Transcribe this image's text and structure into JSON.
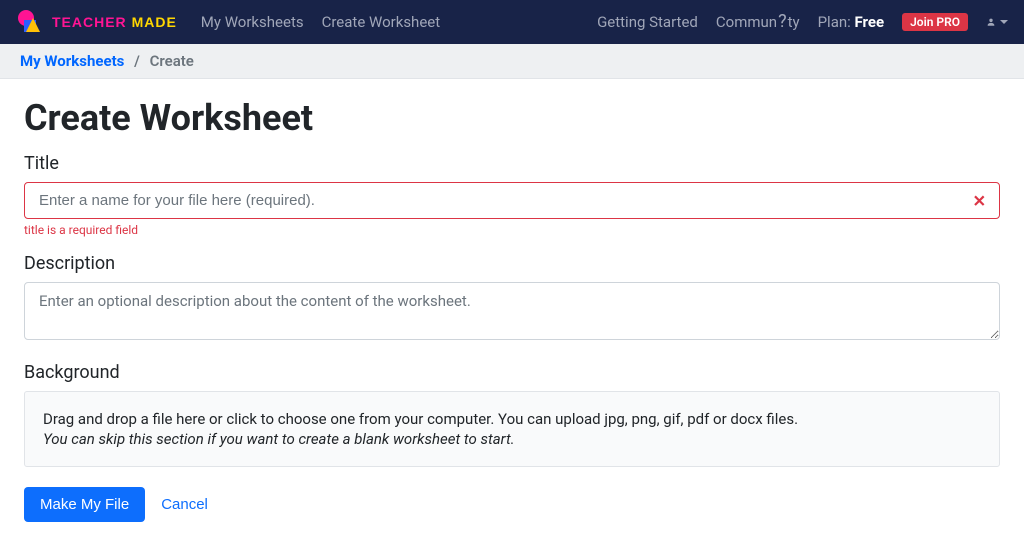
{
  "brand": {
    "teacher": "TEACHER",
    "made": "MADE"
  },
  "nav": {
    "my_worksheets": "My Worksheets",
    "create_worksheet": "Create Worksheet",
    "getting_started": "Getting Started",
    "community_prefix": "Commun",
    "community_suffix": "ty",
    "plan_label": "Plan: ",
    "plan_value": "Free",
    "join_pro": "Join PRO"
  },
  "breadcrumb": {
    "my_worksheets": "My Worksheets",
    "separator": "/",
    "current": "Create"
  },
  "page": {
    "title": "Create Worksheet"
  },
  "form": {
    "title_label": "Title",
    "title_placeholder": "Enter a name for your file here (required).",
    "title_error": "title is a required field",
    "description_label": "Description",
    "description_placeholder": "Enter an optional description about the content of the worksheet.",
    "background_label": "Background",
    "dropzone_text": "Drag and drop a file here or click to choose one from your computer. You can upload jpg, png, gif, pdf or docx files.",
    "dropzone_subtext": "You can skip this section if you want to create a blank worksheet to start.",
    "submit": "Make My File",
    "cancel": "Cancel"
  }
}
